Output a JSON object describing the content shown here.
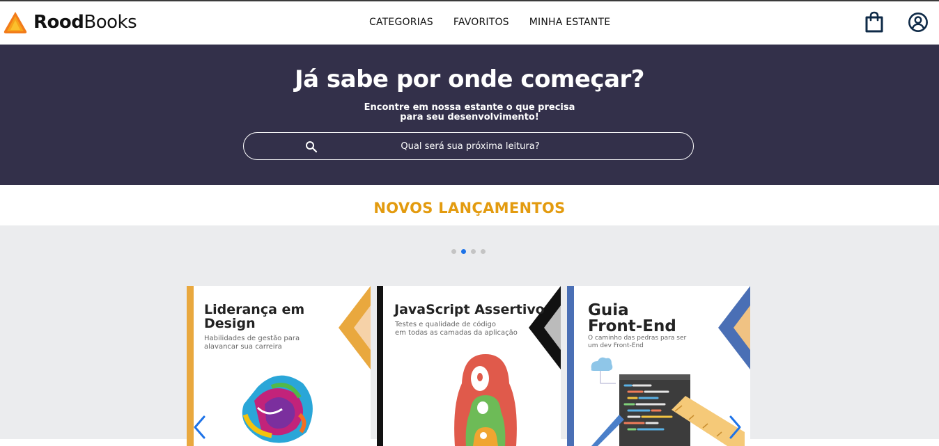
{
  "brand": {
    "name_bold": "Rood",
    "name_light": "Books"
  },
  "nav": {
    "items": [
      "CATEGORIAS",
      "FAVORITOS",
      "MINHA ESTANTE"
    ]
  },
  "hero": {
    "title": "Já sabe por onde começar?",
    "subtitle_line1": "Encontre em nossa estante o que precisa",
    "subtitle_line2": "para seu desenvolvimento!",
    "search_placeholder": "Qual será sua próxima leitura?"
  },
  "releases": {
    "title": "NOVOS LANÇAMENTOS",
    "dots": 4,
    "active_dot": 1,
    "books": [
      {
        "title_line1": "Liderança em",
        "title_line2": "Design",
        "subtitle_line1": "Habilidades de gestão para",
        "subtitle_line2": "alavancar sua carreira",
        "accent": "#e9a83e"
      },
      {
        "title_line1": "JavaScript Assertivo",
        "title_line2": "",
        "subtitle_line1": "Testes e qualidade de código",
        "subtitle_line2": "em todas as camadas da aplicação",
        "accent": "#111111"
      },
      {
        "title_line1": "Guia",
        "title_line2": "Front-End",
        "subtitle_line1": "O caminho das pedras para ser",
        "subtitle_line2": "um dev Front-End",
        "accent": "#4a6fb5"
      }
    ]
  },
  "colors": {
    "hero_bg": "#33304a",
    "accent_orange": "#e39b0f",
    "carousel_bg": "#ebecee",
    "active_dot": "#1e73e8"
  }
}
